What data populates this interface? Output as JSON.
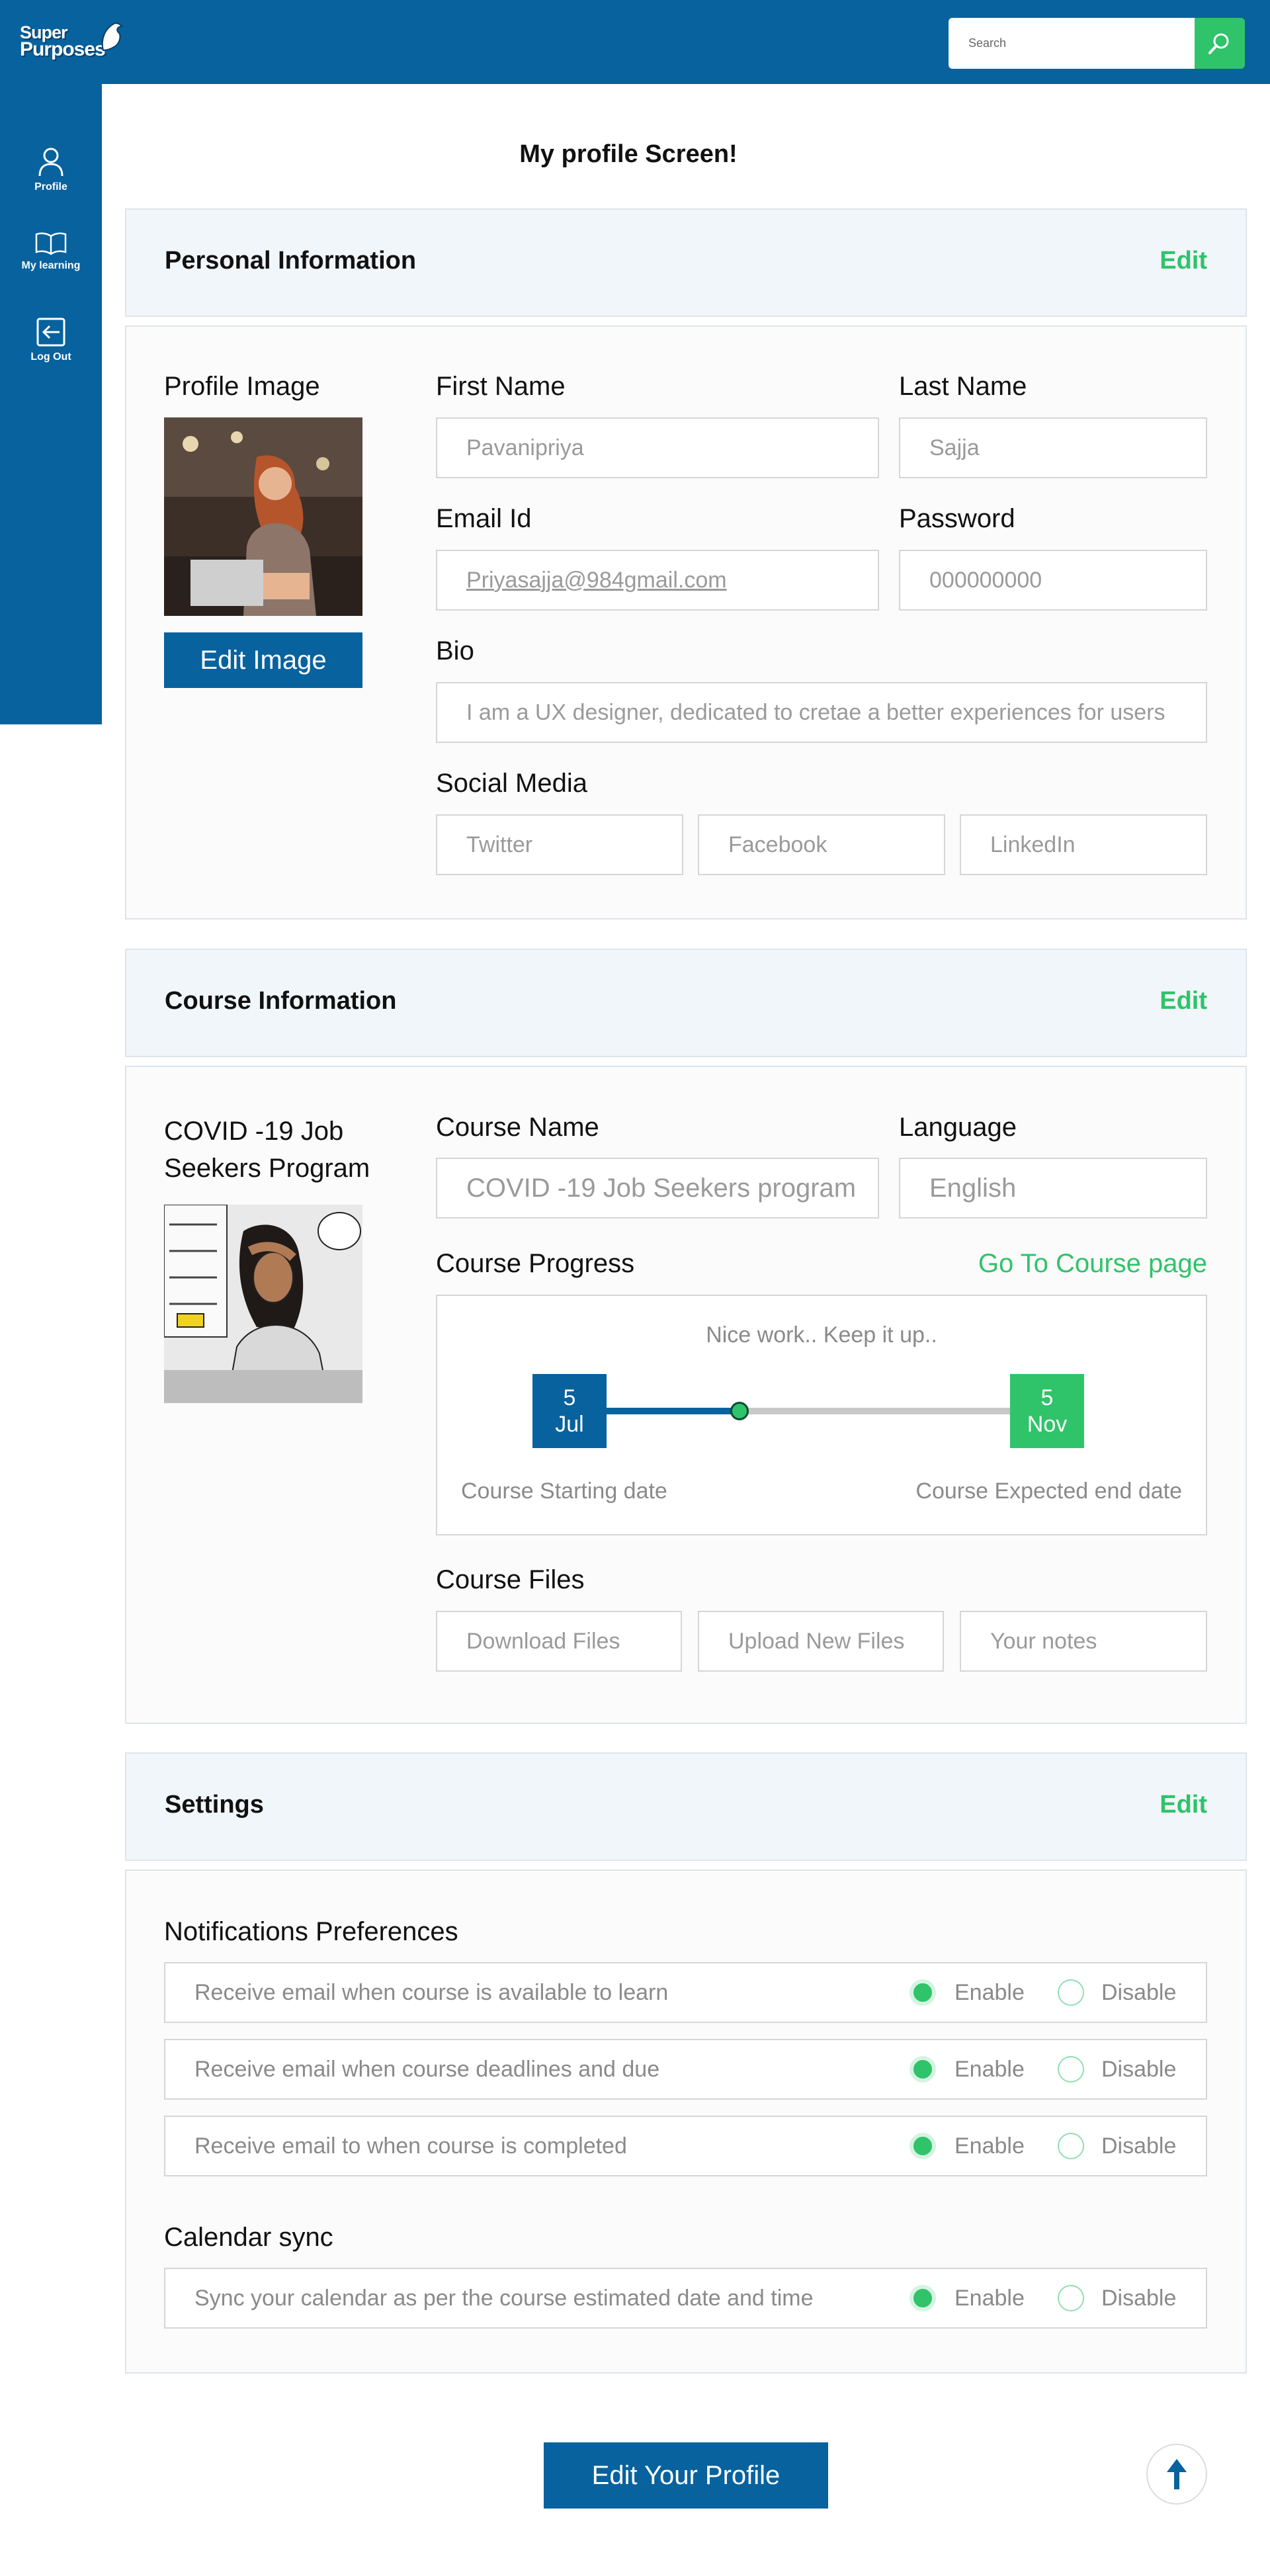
{
  "header": {
    "logo_line1": "Super",
    "logo_line2": "Purposes",
    "search_placeholder": "Search"
  },
  "sidebar": {
    "items": [
      {
        "label": "Profile",
        "icon": "user-icon"
      },
      {
        "label": "My learning",
        "icon": "book-icon"
      },
      {
        "label": "Log Out",
        "icon": "logout-icon"
      }
    ]
  },
  "page_title": "My profile Screen!",
  "personal": {
    "title": "Personal Information",
    "edit": "Edit",
    "profile_image_label": "Profile Image",
    "edit_image_button": "Edit Image",
    "first_name_label": "First Name",
    "first_name": "Pavanipriya",
    "last_name_label": "Last Name",
    "last_name": "Sajja",
    "email_label": "Email Id",
    "email": "Priyasajja@984gmail.com",
    "password_label": "Password",
    "password": "000000000",
    "bio_label": "Bio",
    "bio": "I am a UX designer, dedicated to cretae a better experiences for users",
    "social_label": "Social Media",
    "social": [
      "Twitter",
      "Facebook",
      "LinkedIn"
    ]
  },
  "course": {
    "title": "Course Information",
    "edit": "Edit",
    "program_title": "COVID -19 Job Seekers Program",
    "course_name_label": "Course Name",
    "course_name": "COVID -19 Job Seekers program",
    "language_label": "Language",
    "language": "English",
    "progress_label": "Course Progress",
    "go_to_course": "Go To Course page",
    "progress_message": "Nice work.. Keep it up..",
    "progress_fraction": 0.33,
    "start_day": "5",
    "start_month": "Jul",
    "end_day": "5",
    "end_month": "Nov",
    "start_caption": "Course Starting date",
    "end_caption": "Course Expected end date",
    "files_label": "Course Files",
    "files": [
      "Download Files",
      "Upload New Files",
      "Your notes"
    ]
  },
  "settings": {
    "title": "Settings",
    "edit": "Edit",
    "notifications_label": "Notifications Preferences",
    "notifications": [
      {
        "text": "Receive email when course is available to learn",
        "selected": "Enable"
      },
      {
        "text": "Receive email when course deadlines and due",
        "selected": "Enable"
      },
      {
        "text": "Receive email to when course is completed",
        "selected": "Enable"
      }
    ],
    "calendar_label": "Calendar sync",
    "calendar": {
      "text": "Sync your calendar as per the course estimated date and time",
      "selected": "Enable"
    },
    "enable_label": "Enable",
    "disable_label": "Disable"
  },
  "footer": {
    "edit_profile_button": "Edit Your Profile",
    "scroll_top_icon": "arrow-up-icon"
  },
  "colors": {
    "brand_blue": "#07629e",
    "accent_green": "#2fc36a",
    "panel_bg": "#f1f6fa"
  }
}
